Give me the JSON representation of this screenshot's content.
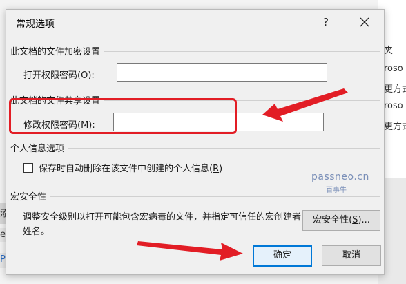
{
  "background": {
    "right_fragments": [
      "夹",
      "roso",
      "更方式",
      "roso",
      "更方式"
    ],
    "left_fragments": [
      "添",
      "er",
      "P"
    ]
  },
  "dialog": {
    "title": "常规选项",
    "help_label": "?",
    "close_label": "✕",
    "encrypt_section": "此文档的文件加密设置",
    "open_password_label_prefix": "打开权限密码(",
    "open_password_hotkey": "O",
    "open_password_label_suffix": "):",
    "open_password_value": "",
    "share_section": "此文档的文件共享设置",
    "modify_password_label_prefix": "修改权限密码(",
    "modify_password_hotkey": "M",
    "modify_password_label_suffix": "):",
    "modify_password_value": "",
    "personal_section": "个人信息选项",
    "remove_info_label_prefix": "保存时自动删除在该文件中创建的个人信息(",
    "remove_info_hotkey": "R",
    "remove_info_label_suffix": ")",
    "remove_info_checked": false,
    "macro_section": "宏安全性",
    "macro_description": "调整安全级别以打开可能包含宏病毒的文件，并指定可信任的宏创建者姓名。",
    "macro_button_prefix": "宏安全性(",
    "macro_button_hotkey": "S",
    "macro_button_suffix": ")...",
    "ok_button": "确定",
    "cancel_button": "取消"
  },
  "watermark": {
    "site": "passneo.cn",
    "brand": "百事牛"
  },
  "colors": {
    "annotation_red": "#e21d25",
    "primary_focus": "#0078d7",
    "dialog_bg": "#f0f0f0"
  }
}
